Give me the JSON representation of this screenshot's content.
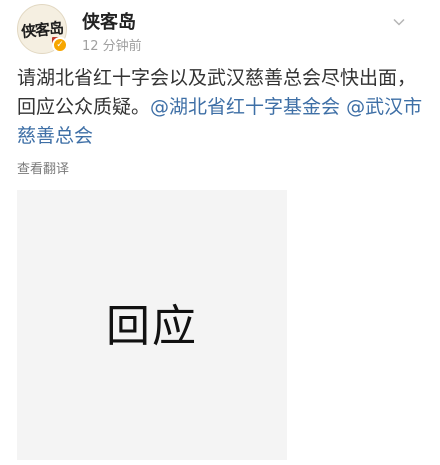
{
  "account": {
    "name": "侠客岛",
    "avatar_text": "侠客岛",
    "timestamp": "12 分钟前",
    "verified_icon": "verified-badge-icon"
  },
  "post": {
    "text_main": "请湖北省红十字会以及武汉慈善总会尽快出面，回应公众质疑。",
    "mention_1": "@湖北省红十字基金会",
    "mention_2": "@武汉市慈善总会",
    "translate_label": "查看翻译"
  },
  "image": {
    "text": "回应"
  },
  "colors": {
    "mention": "#3e6fa6",
    "verified": "#f7a600"
  }
}
